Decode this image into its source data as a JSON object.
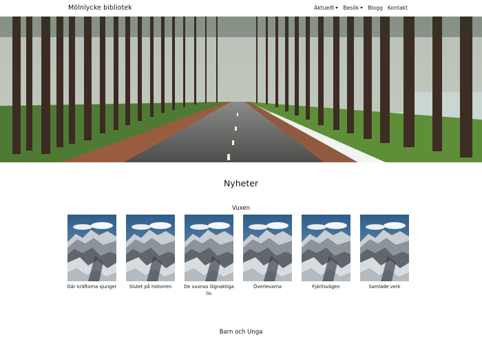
{
  "navbar": {
    "brand": "Mölnlycke bibliotek",
    "items": [
      {
        "label": "Aktuellt",
        "dropdown": true
      },
      {
        "label": "Besök",
        "dropdown": true
      },
      {
        "label": "Blogg",
        "dropdown": false
      },
      {
        "label": "Kontakt",
        "dropdown": false
      }
    ]
  },
  "hero": {
    "image": "forest road lined with pine trees"
  },
  "news": {
    "heading": "Nyheter",
    "adults": {
      "heading": "Vuxen",
      "books": [
        {
          "title": "Där kräftorna sjunger",
          "cover": "snowy mountain range"
        },
        {
          "title": "Slutet på historien",
          "cover": "snowy mountain range"
        },
        {
          "title": "De vuxnas lögnaktiga liv",
          "cover": "snowy mountain range"
        },
        {
          "title": "Överlevarna",
          "cover": "snowy mountain range"
        },
        {
          "title": "Fjärilsvägen",
          "cover": "snowy mountain range"
        },
        {
          "title": "Samlade verk",
          "cover": "snowy mountain range"
        }
      ]
    },
    "kids": {
      "heading": "Barn och Unga"
    }
  },
  "colors": {
    "background": "#ffffff",
    "text": "#111111"
  }
}
